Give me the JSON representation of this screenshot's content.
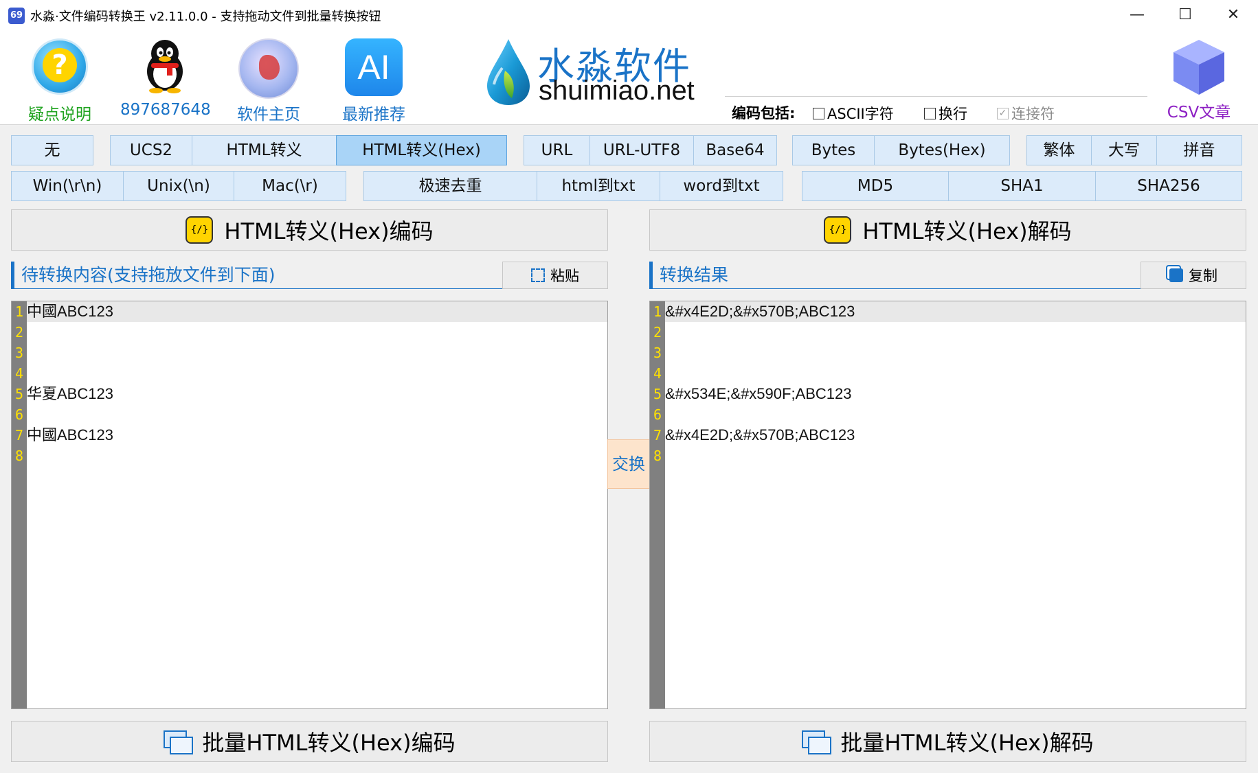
{
  "window": {
    "title": "水淼·文件编码转换王 v2.11.0.0 - 支持拖动文件到批量转换按钮",
    "app_icon_text": "69",
    "minimize": "—",
    "maximize": "☐",
    "close": "✕"
  },
  "toolbar": {
    "items": [
      {
        "label": "疑点说明",
        "color": "#1fa31f",
        "icon": "help-icon"
      },
      {
        "label": "897687648",
        "color": "#1a73c7",
        "icon": "qq-penguin-icon"
      },
      {
        "label": "软件主页",
        "color": "#1a73c7",
        "icon": "globe-icon"
      },
      {
        "label": "最新推荐",
        "color": "#1a73c7",
        "icon": "ai-icon",
        "icon_text": "AI"
      }
    ],
    "logo_cn": "水淼软件",
    "logo_en": "shuimiao.net",
    "csv_label": "CSV文章"
  },
  "encoding_options": {
    "label": "编码包括:",
    "ascii": {
      "label": "ASCII字符",
      "checked": false
    },
    "newline": {
      "label": "换行",
      "checked": false
    },
    "join": {
      "label": "连接符",
      "checked": true,
      "disabled": true
    }
  },
  "modes_row1": [
    "无",
    "UCS2",
    "HTML转义",
    "HTML转义(Hex)",
    "URL",
    "URL-UTF8",
    "Base64",
    "Bytes",
    "Bytes(Hex)",
    "繁体",
    "大写",
    "拼音"
  ],
  "modes_row2": [
    "Win(\\r\\n)",
    "Unix(\\n)",
    "Mac(\\r)",
    "极速去重",
    "html到txt",
    "word到txt",
    "MD5",
    "SHA1",
    "SHA256"
  ],
  "active_mode": "HTML转义(Hex)",
  "encode_button": "HTML转义(Hex)编码",
  "decode_button": "HTML转义(Hex)解码",
  "code_icon_text": "{/}",
  "input_panel": {
    "title": "待转换内容(支持拖放文件到下面)",
    "paste_button": "粘贴",
    "lines": [
      "中國ABC123",
      "",
      "",
      "",
      "华夏ABC123",
      "",
      "中國ABC123",
      ""
    ]
  },
  "output_panel": {
    "title": "转换结果",
    "copy_button": "复制",
    "lines": [
      "&#x4E2D;&#x570B;ABC123",
      "",
      "",
      "",
      "&#x534E;&#x590F;ABC123",
      "",
      "&#x4E2D;&#x570B;ABC123",
      ""
    ]
  },
  "swap_button": "交换",
  "batch_encode_button": "批量HTML转义(Hex)编码",
  "batch_decode_button": "批量HTML转义(Hex)解码",
  "colors": {
    "accent": "#1a73c7",
    "mode_bg": "#dcebfa",
    "mode_active_bg": "#a9d4f7",
    "gutter": "#808080",
    "line_number": "#ffe100",
    "csv": "#8c1fc3"
  }
}
